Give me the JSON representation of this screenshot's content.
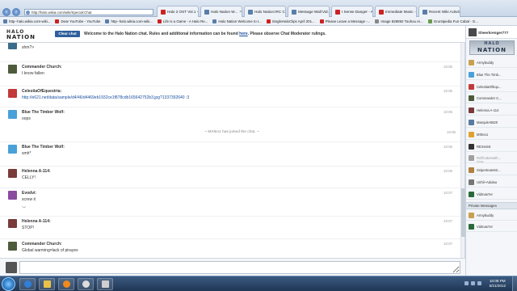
{
  "browser": {
    "url": "http://halo.wikia.com/wiki/Special:Chat",
    "tabs": [
      {
        "label": "http://halo.wikia.com/wiki/Special:Chat",
        "icon": "wiki-favicon",
        "active": true
      },
      {
        "label": "Halo 2 OST Vol.1 -",
        "icon": "youtube-favicon"
      },
      {
        "label": "Halo Nation W...",
        "icon": "wiki-favicon"
      },
      {
        "label": "Halo Nation:IRC C...",
        "icon": "wiki-favicon"
      },
      {
        "label": "Message Wall:Vid...",
        "icon": "wiki-favicon"
      },
      {
        "label": "I Sense Danger - A...",
        "icon": "youtube-favicon"
      },
      {
        "label": "Immediate Music -...",
        "icon": "youtube-favicon"
      },
      {
        "label": "Recent Wiki Activit...",
        "icon": "wiki-favicon"
      }
    ],
    "bookmarks": [
      "http--halo.wikia.com-wiki...",
      "Dear YouTube - YouTube",
      "http--halo.wikia.com-wiki...",
      "Life is a Game - A Halo Re...",
      "Halo Nation Welcome to t...",
      "SingleHaloClips April 201...",
      "Please Leave a Message -...",
      "Image 828892 Touhou re...",
      "Gruntipedia Fun Cabal - G..."
    ]
  },
  "chat": {
    "logo_line1": "HALO",
    "logo_line2": "NATION",
    "clear_button": "Clear chat",
    "welcome_pre": "Welcome to the Halo Nation chat. Rules and additional information can be found ",
    "welcome_link": "here",
    "welcome_post": ". Please observe Chat Moderator rulings.",
    "messages": [
      {
        "user": "",
        "text": "shm?>",
        "time": ""
      },
      {
        "user": "Commander Church:",
        "text": "I know fallen",
        "time": "10:05"
      },
      {
        "user": "CelestiaOfEquestria:",
        "text": "http://e621.net/data/sample/d4/46/d4469eb1932ce1f878cdb165642752b3.jpg?1337392640 :3",
        "time": "10:05"
      },
      {
        "user": "Blue The Timber Wolf:",
        "text": "oops",
        "time": "10:05"
      },
      {
        "user": "Blue The Timber Wolf:",
        "text": "smh*",
        "time": "10:06"
      },
      {
        "user": "Helenna A-114:",
        "text": "CELLY!",
        "time": "10:06"
      },
      {
        "user": "Evodvi:",
        "text": "screw it",
        "text2": "._.",
        "time": "10:07"
      },
      {
        "user": "Helenna A-114:",
        "text": "STOP!",
        "time": "10:07"
      },
      {
        "user": "Commander Church:",
        "text": "Global warming=lack of pirayes",
        "time": "10:07"
      }
    ],
    "join_notice": "~ MXleo1 has joined the chat. ~",
    "join_time": "10:06",
    "input_value": ""
  },
  "sidebar": {
    "me": "Sheerkrenger777",
    "logo_line1": "HALO",
    "logo_line2": "NATION",
    "users": [
      {
        "name": "Armybuddy"
      },
      {
        "name": "Blue The Timb..."
      },
      {
        "name": "CelestiaOfEqu..."
      },
      {
        "name": "Commander C..."
      },
      {
        "name": "Helenna A-114"
      },
      {
        "name": "Marquis-B520"
      },
      {
        "name": "MXleo1"
      },
      {
        "name": "REXenist"
      },
      {
        "name": "RoflCakeswith...",
        "sub": "Away"
      },
      {
        "name": "Sniperteam62..."
      },
      {
        "name": "Unhil~Adulau"
      },
      {
        "name": "Vidmas7er"
      }
    ],
    "private_header": "Private Messages",
    "private": [
      {
        "name": "Armybuddy"
      },
      {
        "name": "Vidmas7er"
      }
    ]
  },
  "taskbar": {
    "time": "10:08 PM",
    "date": "5/21/2012"
  },
  "colors": {
    "clear_button": "#2e5f9c",
    "link": "#1a4fa0",
    "taskbar": "#1f3654"
  }
}
